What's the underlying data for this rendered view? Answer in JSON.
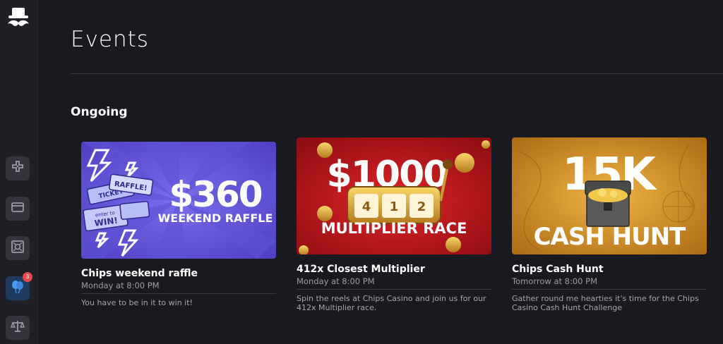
{
  "sidebar": {
    "logo_icon": "mustache-hat-logo",
    "items": [
      {
        "icon": "gamepad-icon"
      },
      {
        "icon": "wallet-icon"
      },
      {
        "icon": "vault-icon"
      },
      {
        "icon": "balloons-icon",
        "badge": "3"
      },
      {
        "icon": "scales-icon"
      }
    ]
  },
  "header": {
    "title": "Events"
  },
  "sections": [
    {
      "title": "Ongoing",
      "events": [
        {
          "image_text": {
            "amount": "$360",
            "subtitle": "WEEKEND RAFFLE",
            "ticket1": "RAFFLE!",
            "ticket2": "TICKET",
            "ticket3": "enter to",
            "ticket4": "WIN!"
          },
          "title": "Chips weekend raffle",
          "time": "Monday at 8:00 PM",
          "description": "You have to be in it to win it!"
        },
        {
          "image_text": {
            "amount": "$1000",
            "reel1": "4",
            "reel2": "1",
            "reel3": "2",
            "subtitle": "MULTIPLIER RACE"
          },
          "title": "412x Closest Multiplier",
          "time": "Monday at 8:00 PM",
          "description": "Spin the reels at Chips Casino and join us for our 412x Multiplier race."
        },
        {
          "image_text": {
            "amount": "15K",
            "subtitle": "CASH HUNT"
          },
          "title": "Chips Cash Hunt",
          "time": "Tomorrow at 8:00 PM",
          "description": "Gather round me hearties it's time for the Chips Casino Cash Hunt Challenge"
        }
      ]
    }
  ],
  "colors": {
    "background": "#191a1f",
    "sidebar": "#1f2026",
    "badge": "#e5484d",
    "accent_active": "#1e3a5e"
  }
}
